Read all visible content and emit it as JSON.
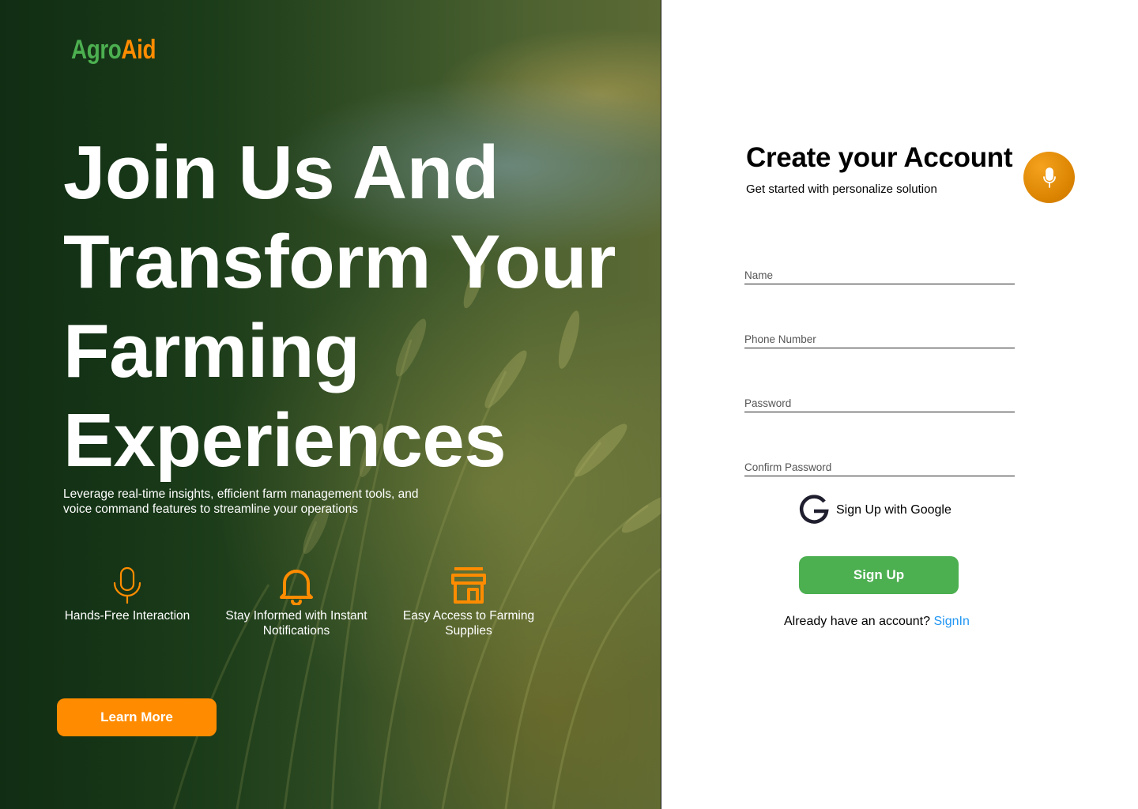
{
  "brand": {
    "part1": "Agro",
    "part2": "Aid",
    "color1": "#4caf50",
    "color2": "#ff8c00"
  },
  "hero": {
    "headline_lines": [
      "Join Us And",
      "Transform Your",
      "Farming",
      "Experiences"
    ],
    "subtext": "Leverage real-time insights, efficient farm management tools, and voice command features to streamline your operations",
    "features": [
      {
        "icon": "microphone-icon",
        "label": "Hands-Free Interaction"
      },
      {
        "icon": "bell-icon",
        "label": "Stay Informed with Instant Notifications"
      },
      {
        "icon": "store-icon",
        "label": "Easy Access to Farming Supplies"
      }
    ],
    "cta_label": "Learn More",
    "accent": "#ff8c00"
  },
  "form": {
    "title": "Create your Account",
    "subtitle": "Get started with personalize solution",
    "voice_icon": "microphone-icon",
    "fields": {
      "name": {
        "placeholder": "Name",
        "value": ""
      },
      "phone": {
        "placeholder": "Phone Number",
        "value": ""
      },
      "password": {
        "placeholder": "Password",
        "value": ""
      },
      "confirm": {
        "placeholder": "Confirm Password",
        "value": ""
      }
    },
    "google_label": "Sign Up with Google",
    "signup_label": "Sign Up",
    "signin_prompt": "Already have an account?",
    "signin_link": "SignIn",
    "primary_color": "#4caf50",
    "link_color": "#2196f3"
  }
}
